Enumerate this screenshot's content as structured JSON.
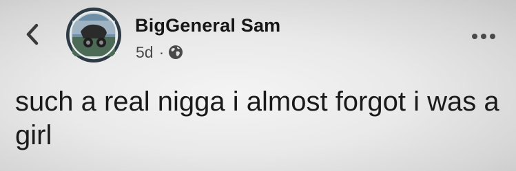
{
  "header": {
    "back_icon": "chevron-left-icon",
    "author_name": "BigGeneral Sam",
    "avatar": "profile-avatar",
    "timestamp": "5d",
    "separator": "·",
    "privacy_icon": "globe-icon",
    "more_icon": "more-horizontal-icon"
  },
  "post": {
    "text": "such a real nigga i almost forgot i was a girl"
  },
  "colors": {
    "background": "#e9e9e9",
    "text": "#1a1a1a",
    "secondary_text": "#4a4a4a"
  }
}
